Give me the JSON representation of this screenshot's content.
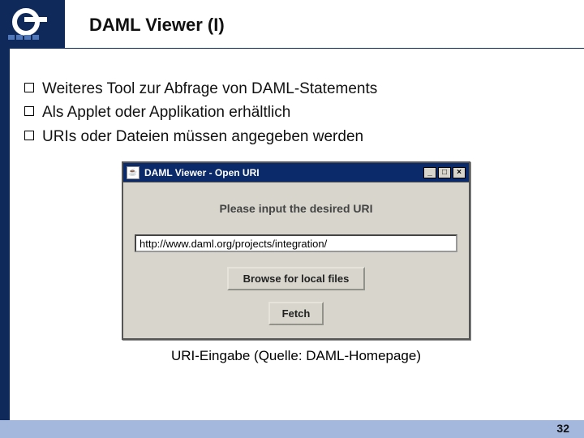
{
  "slide": {
    "title": "DAML Viewer (I)",
    "bullets": [
      "Weiteres Tool zur Abfrage von DAML-Statements",
      "Als Applet oder Applikation erhältlich",
      "URIs oder Dateien müssen angegeben werden"
    ],
    "caption": "URI-Eingabe (Quelle: DAML-Homepage)",
    "page_number": "32"
  },
  "window": {
    "title": "DAML Viewer - Open URI",
    "app_icon_glyph": "☕",
    "minimize_glyph": "_",
    "maximize_glyph": "□",
    "close_glyph": "×",
    "prompt": "Please input the desired URI",
    "uri_value": "http://www.daml.org/projects/integration/",
    "browse_label": "Browse for local files",
    "fetch_label": "Fetch"
  }
}
